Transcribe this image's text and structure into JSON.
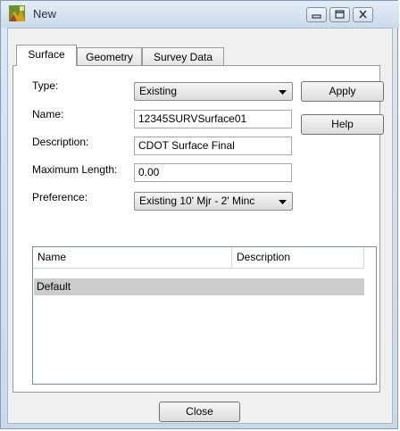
{
  "window": {
    "title": "New"
  },
  "tabs": [
    {
      "label": "Surface",
      "active": true
    },
    {
      "label": "Geometry",
      "active": false
    },
    {
      "label": "Survey Data",
      "active": false
    }
  ],
  "form": {
    "type": {
      "label": "Type:",
      "value": "Existing"
    },
    "name": {
      "label": "Name:",
      "value": "12345SURVSurface01"
    },
    "description": {
      "label": "Description:",
      "value": "CDOT Surface Final"
    },
    "max_length": {
      "label": "Maximum Length:",
      "value": "0.00"
    },
    "preference": {
      "label": "Preference:",
      "value": "Existing 10' Mjr - 2' Minc"
    }
  },
  "buttons": {
    "apply": "Apply",
    "help": "Help",
    "close": "Close"
  },
  "list": {
    "columns": [
      "Name",
      "Description"
    ],
    "rows": [
      {
        "name": "Default",
        "description": "",
        "selected": true
      }
    ]
  },
  "colors": {
    "titlebar": "#cbdaeb",
    "selection": "#cccccc",
    "panel": "#ffffff",
    "client": "#f0f0f0"
  }
}
